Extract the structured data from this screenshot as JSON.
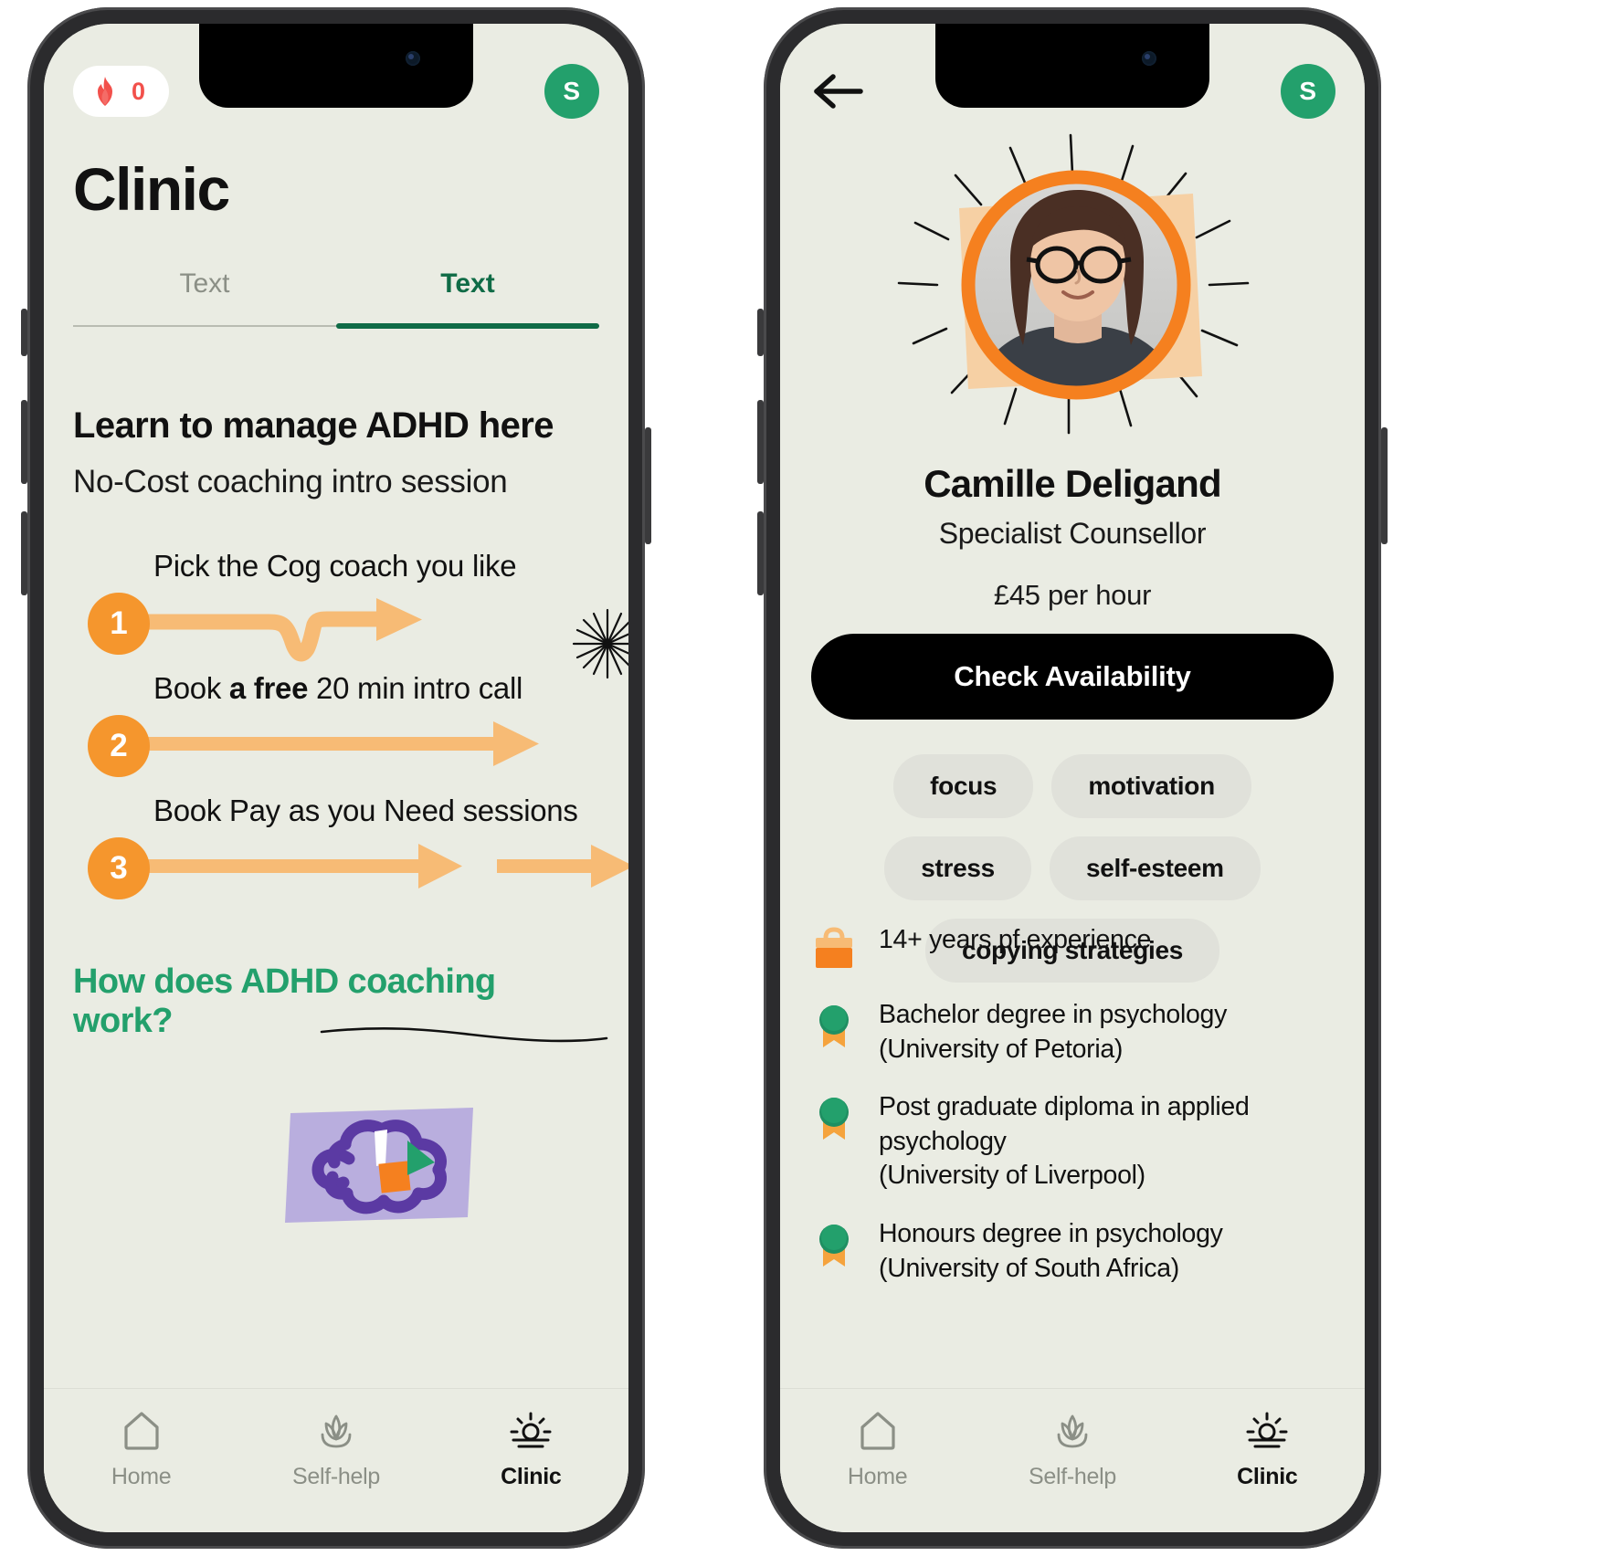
{
  "theme": {
    "background": "#eaece3",
    "accent_green": "#23a06c",
    "accent_dark_green": "#0f6b46",
    "accent_orange": "#f5962d",
    "arrow_orange": "#f7bb75",
    "streak_red": "#f2504b",
    "tag_grey": "#e0e1da",
    "purple": "#5b3aa3",
    "lavender": "#b9aede",
    "peach": "#f6d0a4"
  },
  "left_phone": {
    "topbar": {
      "streak_icon": "flame-icon",
      "streak_count": "0",
      "avatar_initial": "S"
    },
    "page_title": "Clinic",
    "tabs": [
      {
        "label": "Text",
        "active": false
      },
      {
        "label": "Text",
        "active": true
      }
    ],
    "lead_title": "Learn to manage ADHD here",
    "lead_subtitle": "No-Cost coaching intro session",
    "steps": [
      {
        "number": "1",
        "label_plain": "Pick the Cog coach you like",
        "label_pre": "Pick the Cog coach you like",
        "label_bold": "",
        "label_post": "",
        "arrow_style": "curved-dip-single"
      },
      {
        "number": "2",
        "label_plain": "Book a free 20 min intro call",
        "label_pre": "Book ",
        "label_bold": "a free",
        "label_post": " 20 min intro call",
        "arrow_style": "straight-single-long"
      },
      {
        "number": "3",
        "label_plain": "Book Pay as you Need sessions",
        "label_pre": "Book Pay as you Need sessions",
        "label_bold": "",
        "label_post": "",
        "arrow_style": "straight-double"
      }
    ],
    "sparkle_icon": "sparkle-starburst-icon",
    "how_title": "How does ADHD coaching work?",
    "brain_illustration": "brain-doodle-illustration"
  },
  "right_phone": {
    "topbar": {
      "back_icon": "back-arrow-icon",
      "avatar_initial": "S"
    },
    "hero": {
      "photo_alt": "counsellor-portrait",
      "frame_color": "#f5962d",
      "sticker_color": "#f6d0a4",
      "rays_icon": "sunburst-rays-icon"
    },
    "name": "Camille Deligand",
    "role": "Specialist Counsellor",
    "rate": "£45 per hour",
    "cta_label": "Check Availability",
    "tags": [
      "focus",
      "motivation",
      "stress",
      "self-esteem",
      "copying strategies"
    ],
    "credentials": [
      {
        "icon": "briefcase-icon",
        "lines": [
          "14+ years pf experience"
        ]
      },
      {
        "icon": "medal-icon",
        "lines": [
          "Bachelor degree in psychology",
          "(University of Petoria)"
        ]
      },
      {
        "icon": "medal-icon",
        "lines": [
          "Post graduate diploma in applied psychology",
          "(University of Liverpool)"
        ]
      },
      {
        "icon": "medal-icon",
        "lines": [
          "Honours degree in psychology",
          "(University of South Africa)"
        ]
      }
    ]
  },
  "bottom_nav": [
    {
      "label": "Home",
      "icon": "home-icon",
      "active": false
    },
    {
      "label": "Self-help",
      "icon": "lotus-icon",
      "active": false
    },
    {
      "label": "Clinic",
      "icon": "sunrise-icon",
      "active": true
    }
  ]
}
